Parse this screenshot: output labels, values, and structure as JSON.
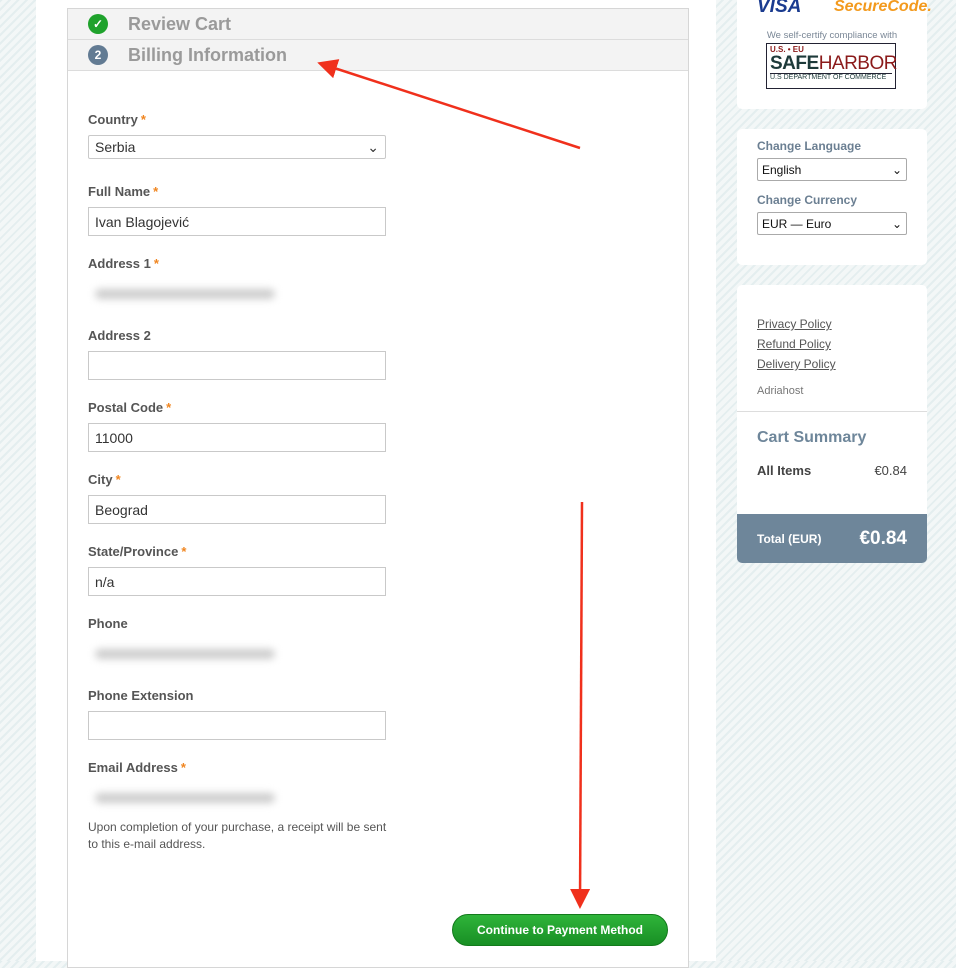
{
  "steps": [
    {
      "num": "✓",
      "label": "Review Cart",
      "color": "#1fa22c"
    },
    {
      "num": "2",
      "label": "Billing Information",
      "color": "#627b93"
    }
  ],
  "fields": [
    {
      "label": "Country",
      "required": true,
      "value": "Serbia",
      "type": "select"
    },
    {
      "label": "Full Name",
      "required": true,
      "value": "Ivan Blagojević",
      "type": "text"
    },
    {
      "label": "Address 1",
      "required": true,
      "value": "",
      "type": "blurred"
    },
    {
      "label": "Address 2",
      "required": false,
      "value": "",
      "type": "text"
    },
    {
      "label": "Postal Code",
      "required": true,
      "value": "11000",
      "type": "text"
    },
    {
      "label": "City",
      "required": true,
      "value": "Beograd",
      "type": "text"
    },
    {
      "label": "State/Province",
      "required": true,
      "value": "n/a",
      "type": "text"
    },
    {
      "label": "Phone",
      "required": false,
      "value": "",
      "type": "blurred"
    },
    {
      "label": "Phone Extension",
      "required": false,
      "value": "",
      "type": "text"
    },
    {
      "label": "Email Address",
      "required": true,
      "value": "",
      "type": "blurred"
    }
  ],
  "email_note": "Upon completion of your purchase, a receipt will be sent to this e-mail address.",
  "continue_button": "Continue to Payment Method",
  "sidebar": {
    "badges": {
      "visa": "VISA",
      "securecode": "SecureCode.",
      "compliance": "We self-certify compliance with",
      "safeharbor_top": "U.S. • EU",
      "safeharbor_a": "SAFE",
      "safeharbor_b": "HARBOR",
      "safeharbor_bottom": "U.S DEPARTMENT OF COMMERCE"
    },
    "language_label": "Change Language",
    "language_value": "English",
    "currency_label": "Change Currency",
    "currency_value": "EUR — Euro",
    "links": [
      "Privacy Policy",
      "Refund Policy",
      "Delivery Policy"
    ],
    "company": "Adriahost",
    "cart_title": "Cart Summary",
    "all_items_label": "All Items",
    "all_items_value": "€0.84",
    "total_label": "Total (EUR)",
    "total_value": "€0.84"
  },
  "colors": {
    "accent": "#f0851f",
    "summary": "#6e869a",
    "button": "#1f9e2b",
    "annotation": "#f0301c"
  }
}
